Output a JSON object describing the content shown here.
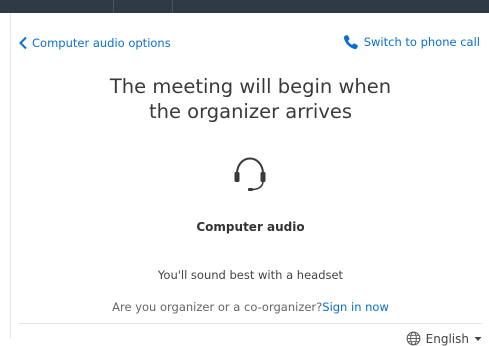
{
  "header": {
    "back_label": "Computer audio options",
    "switch_label": "Switch to phone call"
  },
  "main": {
    "headline_line1": "The meeting will begin when",
    "headline_line2": "the organizer arrives",
    "audio_title": "Computer audio",
    "tip": "You'll sound best with a headset",
    "organizer_question": "Are you organizer or a co-organizer?",
    "sign_in_label": "Sign in now"
  },
  "footer": {
    "language": "English"
  },
  "colors": {
    "link": "#0b6fcf",
    "topbar": "#2f3a45",
    "headline": "#3a3a3a"
  },
  "icons": {
    "back": "chevron-left-icon",
    "phone": "phone-icon",
    "headset": "headset-icon",
    "language": "globe-icon",
    "dropdown": "caret-down-icon"
  }
}
